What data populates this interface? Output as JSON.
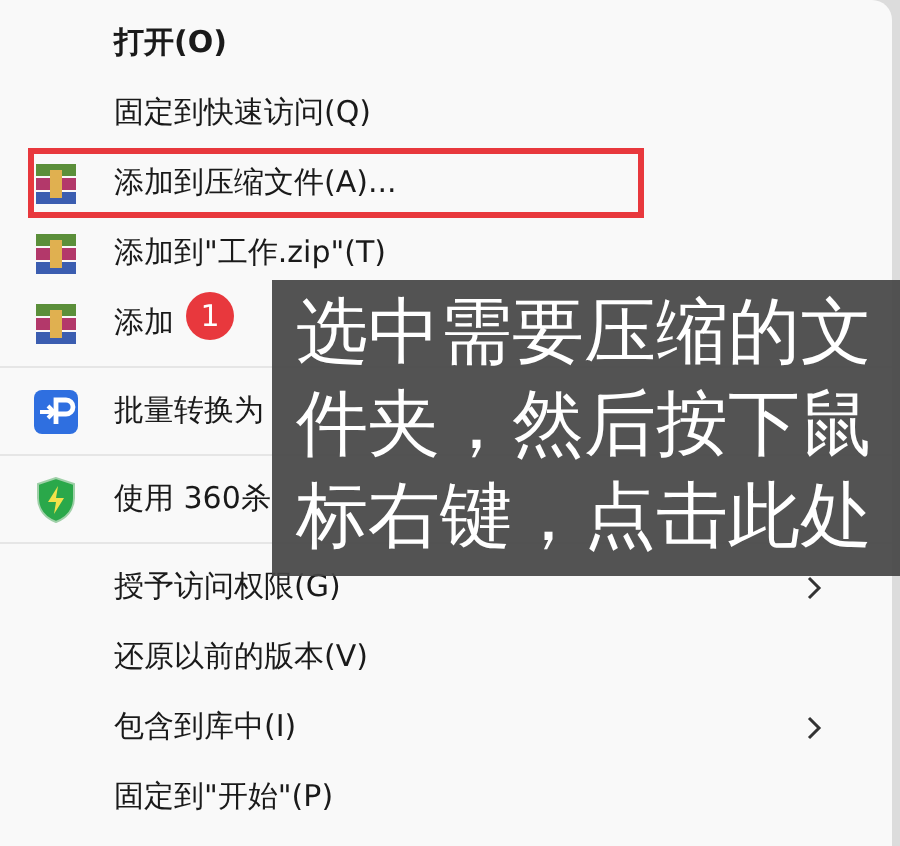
{
  "menu": {
    "groups": [
      [
        {
          "label": "打开(O)",
          "kind": "plain",
          "bold": true,
          "submenu": false,
          "highlighted": false
        },
        {
          "label": "固定到快速访问(Q)",
          "kind": "plain",
          "bold": false,
          "submenu": false,
          "highlighted": false
        },
        {
          "label": "添加到压缩文件(A)...",
          "kind": "archive",
          "bold": false,
          "submenu": false,
          "highlighted": true
        },
        {
          "label": "添加到\"工作.zip\"(T)",
          "kind": "archive",
          "bold": false,
          "submenu": false,
          "highlighted": false
        },
        {
          "label": "添加",
          "kind": "archive",
          "bold": false,
          "submenu": false,
          "highlighted": false
        }
      ],
      [
        {
          "label": "批量转换为",
          "kind": "convert",
          "bold": false,
          "submenu": false,
          "highlighted": false
        }
      ],
      [
        {
          "label": "使用 360杀",
          "kind": "antivirus",
          "bold": false,
          "submenu": false,
          "highlighted": false
        }
      ],
      [
        {
          "label": "授予访问权限(G)",
          "kind": "plain",
          "bold": false,
          "submenu": true,
          "highlighted": false
        },
        {
          "label": "还原以前的版本(V)",
          "kind": "plain",
          "bold": false,
          "submenu": false,
          "highlighted": false
        },
        {
          "label": "包含到库中(I)",
          "kind": "plain",
          "bold": false,
          "submenu": true,
          "highlighted": false
        },
        {
          "label": "固定到\"开始\"(P)",
          "kind": "plain",
          "bold": false,
          "submenu": false,
          "highlighted": false
        }
      ]
    ]
  },
  "callout": {
    "text": "选中需要压缩的文件夹，然后按下鼠标右键，点击此处"
  },
  "step_badge": {
    "text": "1"
  }
}
